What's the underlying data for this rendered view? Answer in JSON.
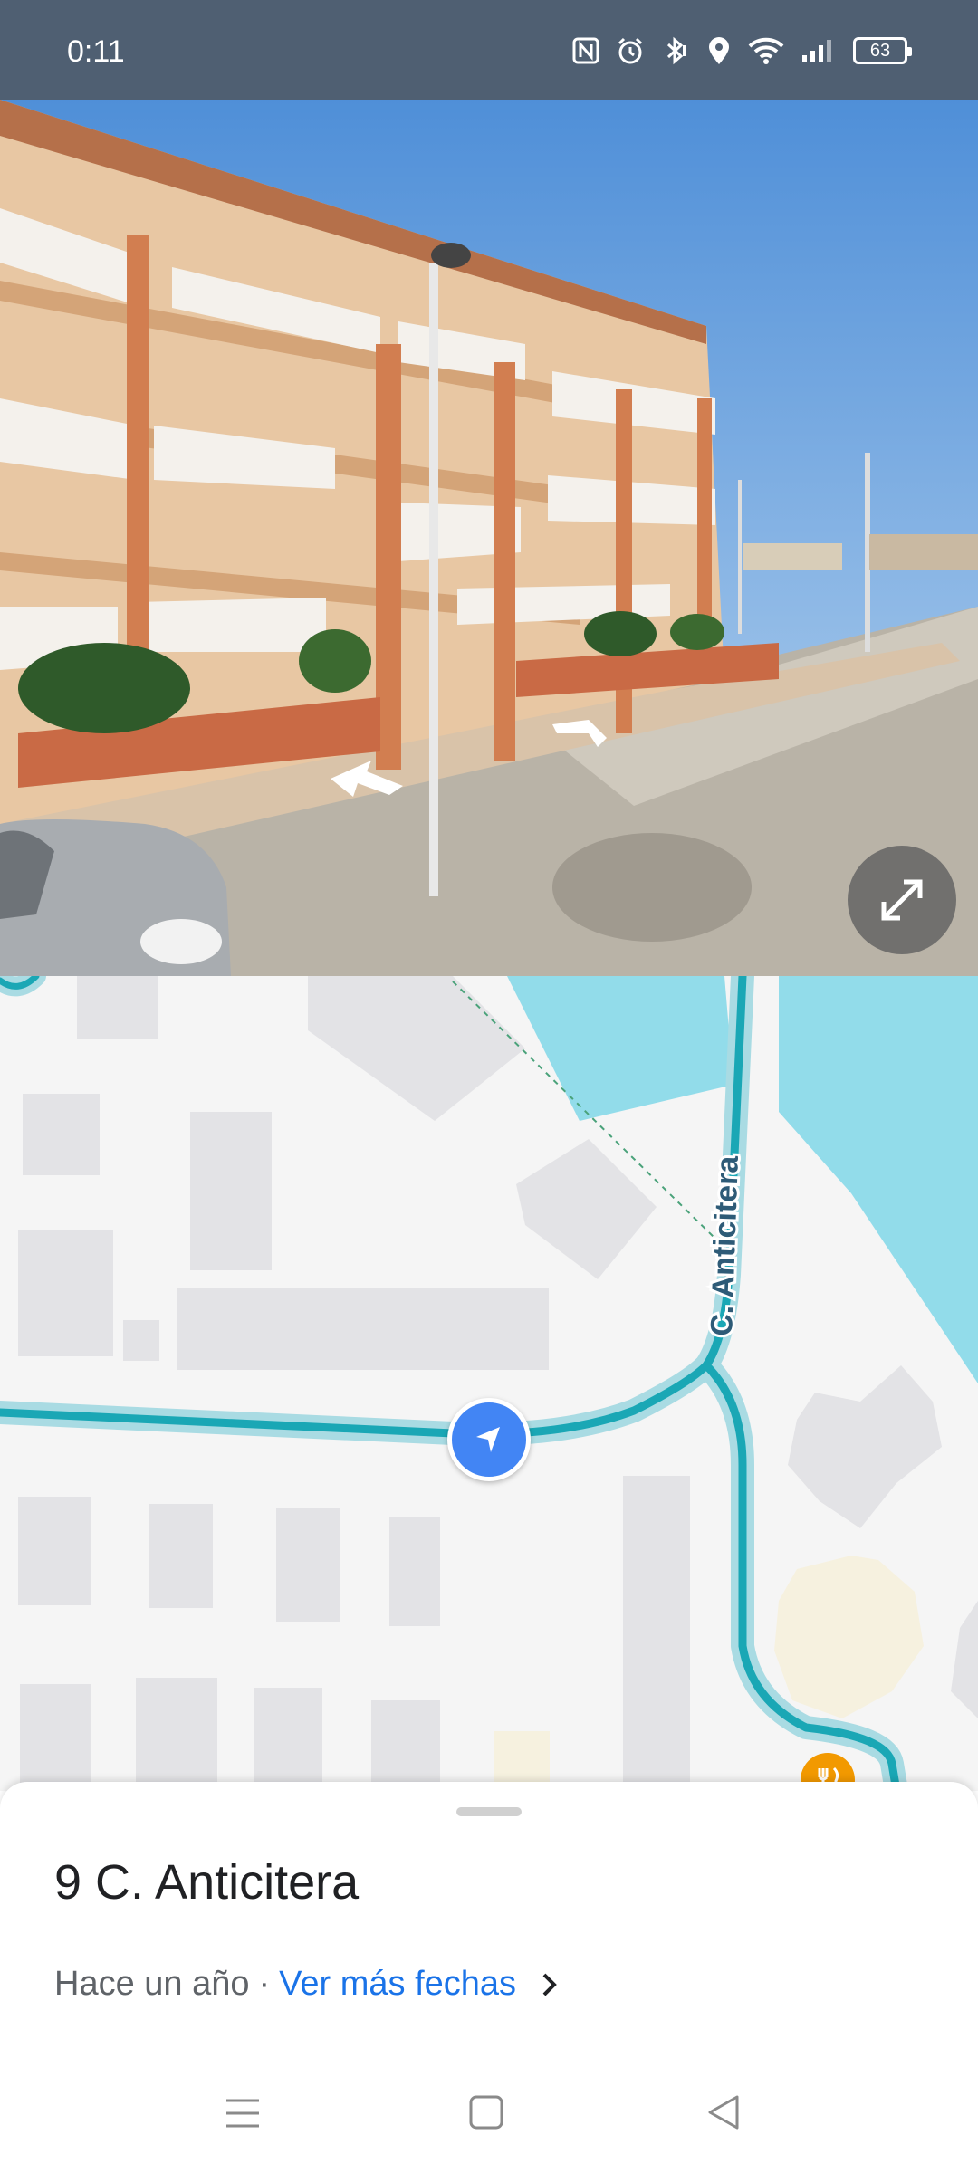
{
  "status_bar": {
    "time": "0:11",
    "icons": [
      "nfc-icon",
      "alarm-icon",
      "bluetooth-icon",
      "location-icon",
      "wifi-icon",
      "signal-icon"
    ],
    "battery": "63"
  },
  "street_view": {
    "expand_icon": "expand-icon"
  },
  "map": {
    "street_label": "C. Anticitera",
    "colors": {
      "road": "#1aa7b5",
      "water": "#92dcea",
      "building": "#e3e3e6",
      "land": "#f5f5f5",
      "restaurant": "#f29900"
    }
  },
  "sheet": {
    "address": "9 C. Anticitera",
    "date_ago": "Hace un año",
    "separator": "·",
    "more_dates": "Ver más fechas"
  },
  "nav": {
    "icons": [
      "menu-icon",
      "home-icon",
      "back-icon"
    ]
  }
}
